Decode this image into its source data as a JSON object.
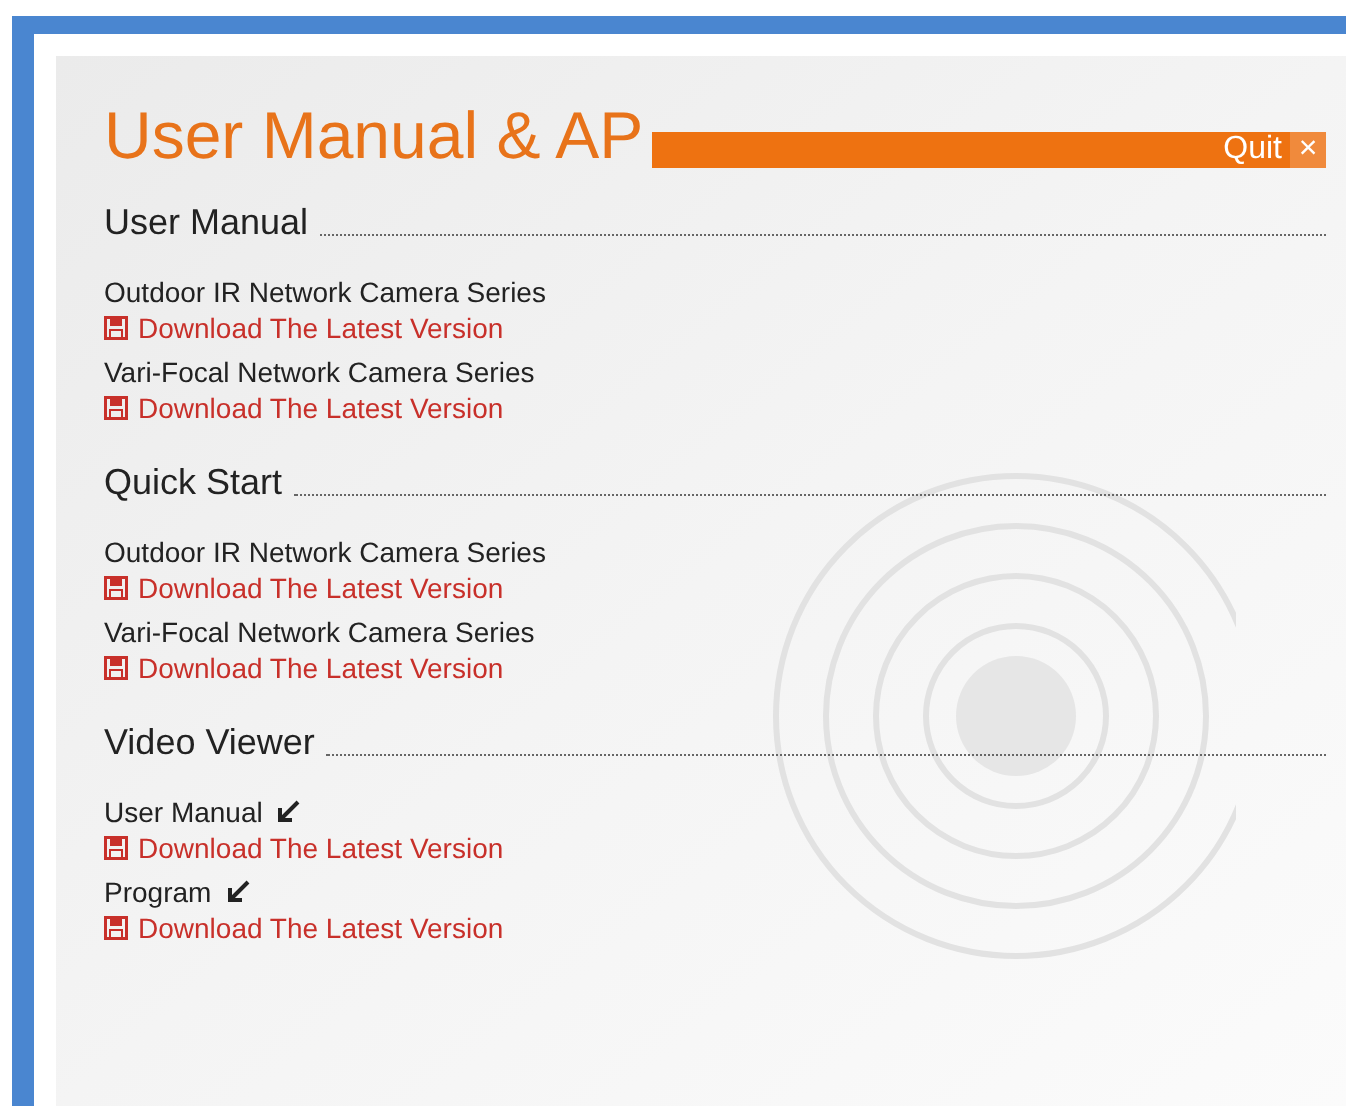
{
  "title": "User Manual & AP",
  "quit": {
    "label": "Quit",
    "close": "×"
  },
  "sections": [
    {
      "heading": "User Manual",
      "items": [
        {
          "kind": "plain",
          "name": "Outdoor IR Network Camera Series",
          "link": "Download The Latest Version"
        },
        {
          "kind": "plain",
          "name": "Vari-Focal Network Camera Series",
          "link": "Download The Latest Version"
        }
      ]
    },
    {
      "heading": "Quick Start",
      "items": [
        {
          "kind": "plain",
          "name": "Outdoor IR Network Camera Series",
          "link": "Download The Latest Version"
        },
        {
          "kind": "plain",
          "name": "Vari-Focal Network Camera Series",
          "link": "Download The Latest Version"
        }
      ]
    },
    {
      "heading": "Video Viewer",
      "items": [
        {
          "kind": "arrow",
          "name": "User Manual",
          "link": "Download The Latest Version"
        },
        {
          "kind": "arrow",
          "name": "Program",
          "link": "Download The Latest Version"
        }
      ]
    }
  ]
}
